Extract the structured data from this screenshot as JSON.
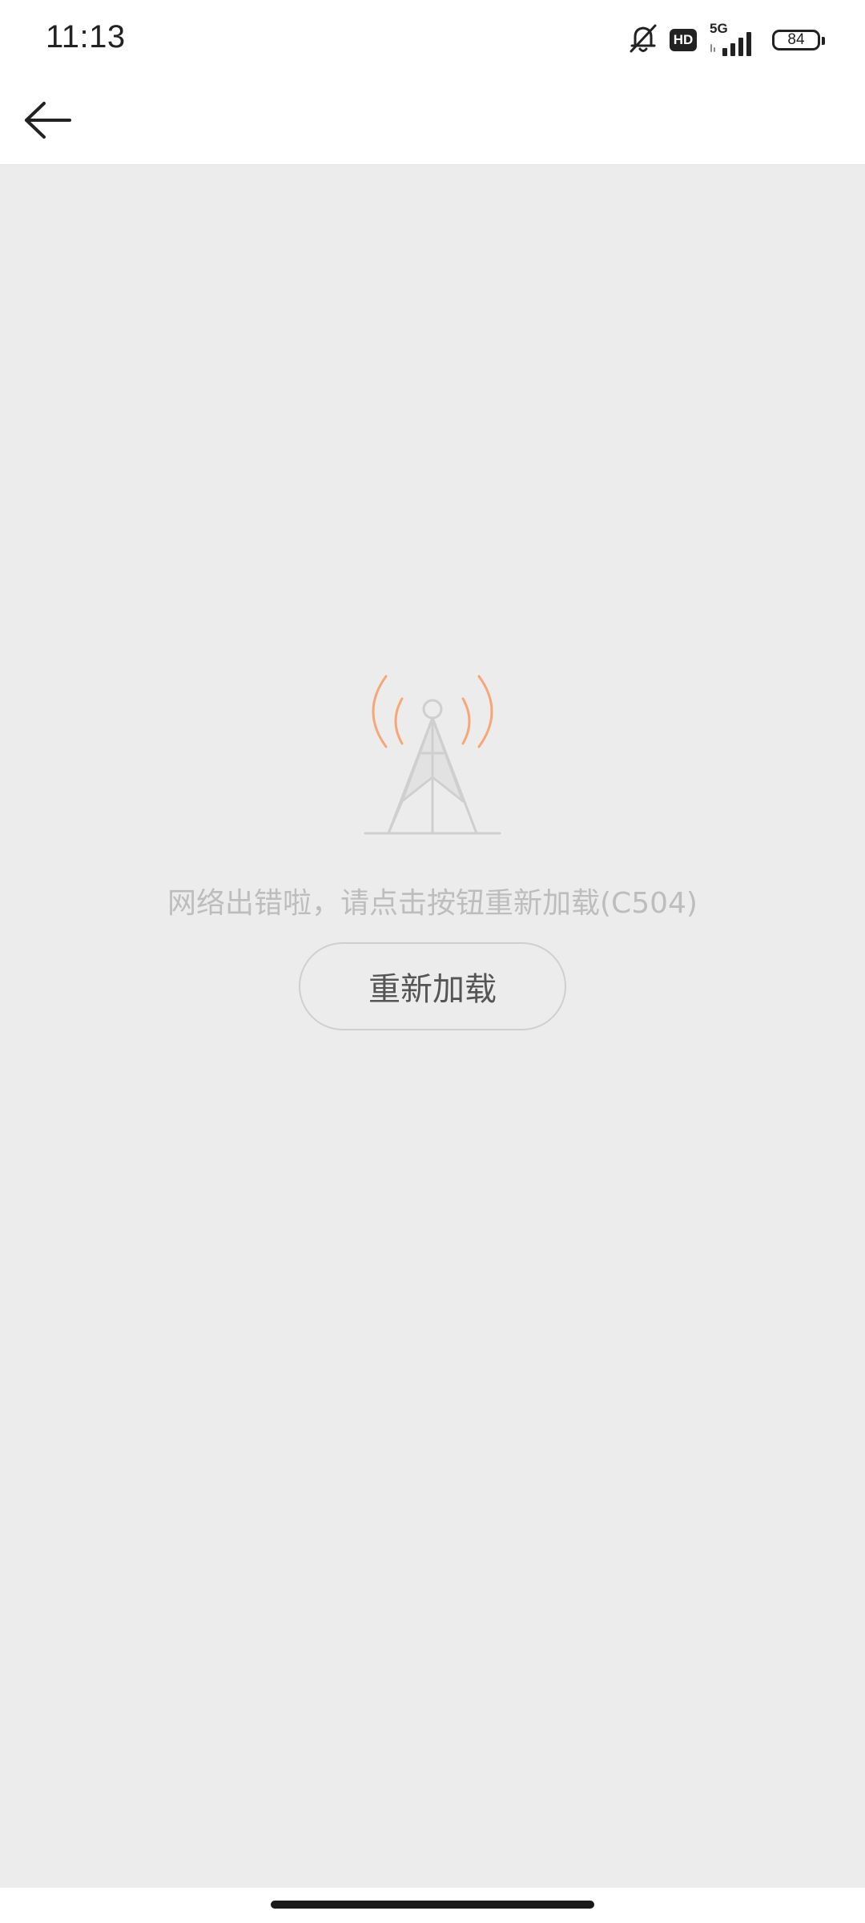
{
  "status_bar": {
    "time": "11:13",
    "network_label": "5G",
    "hd_label": "HD",
    "battery_level": "84",
    "icons": [
      "bell-muted-icon",
      "hd-icon",
      "signal-5g-icon",
      "battery-icon"
    ]
  },
  "header": {
    "back_icon": "arrow-left-icon"
  },
  "error": {
    "illustration_icon": "signal-tower-icon",
    "message": "网络出错啦，请点击按钮重新加载(C504)",
    "reload_label": "重新加载"
  },
  "colors": {
    "background": "#ececec",
    "wave_accent": "#f7a777",
    "muted_text": "#bdbdbd",
    "button_border": "#cfcfcf"
  }
}
